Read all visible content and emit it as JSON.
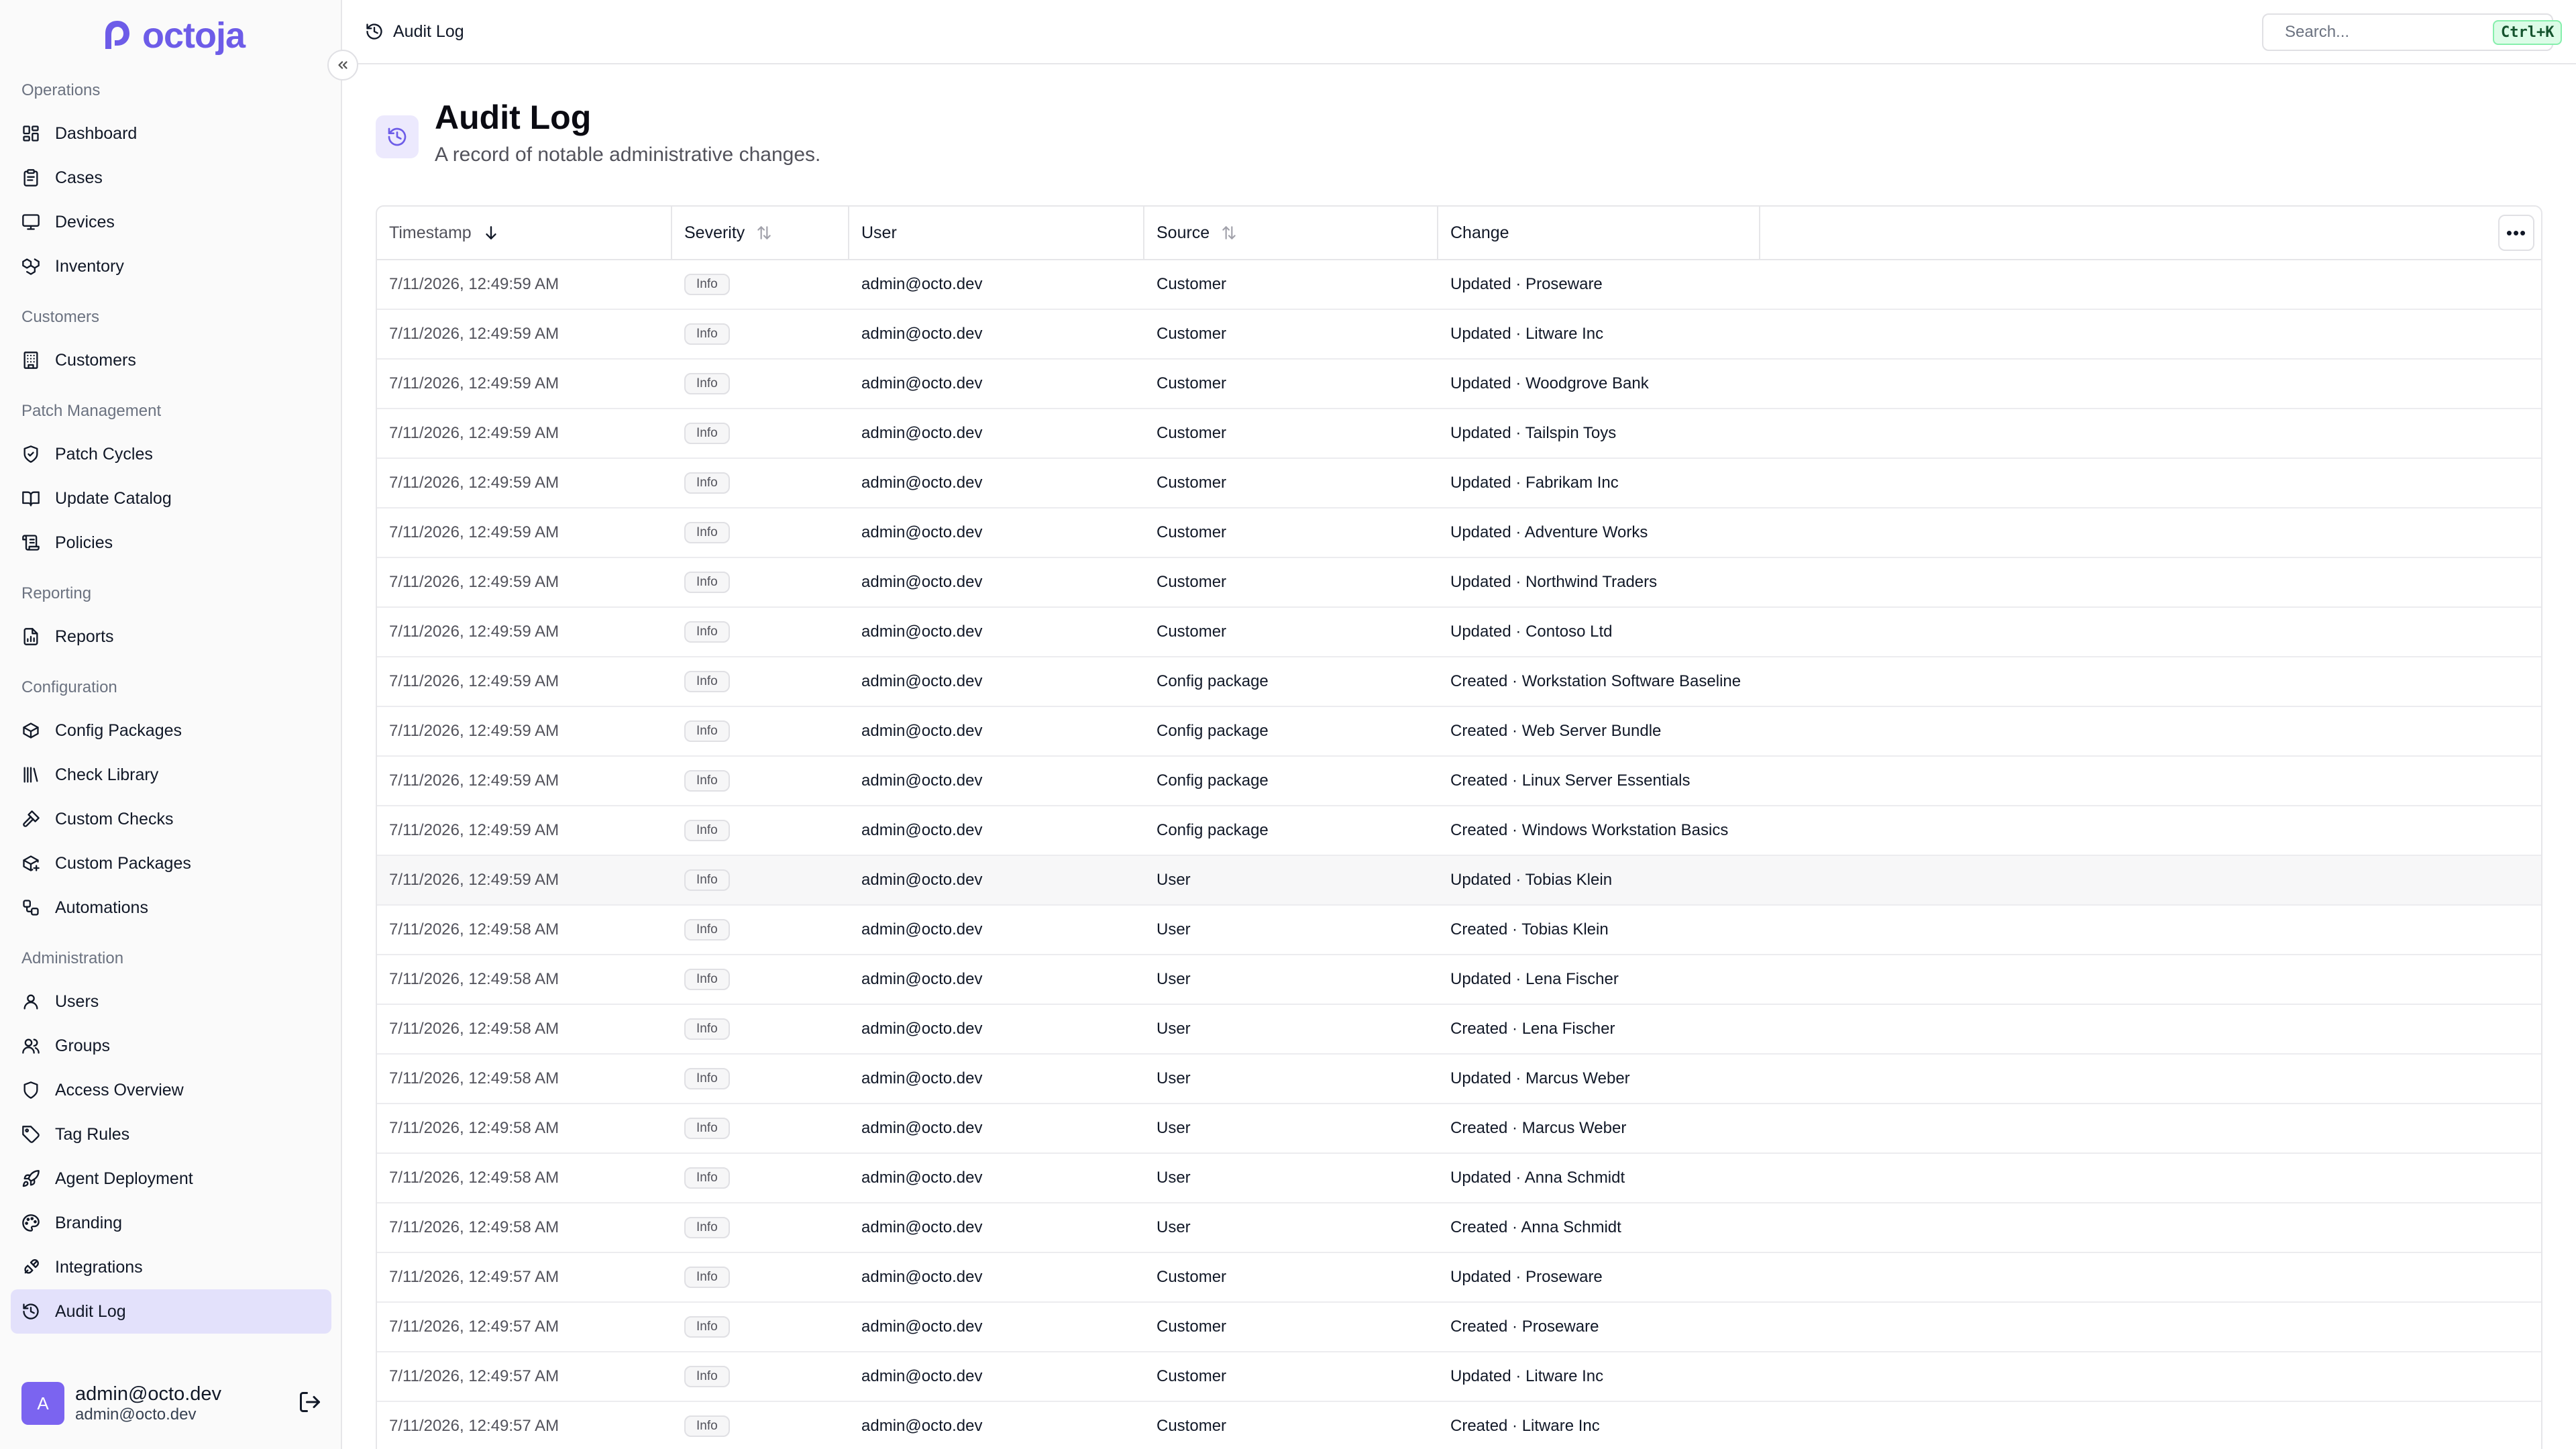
{
  "app": {
    "name": "octoja"
  },
  "sidebar": {
    "groups": [
      {
        "label": "Operations",
        "items": [
          {
            "label": "Dashboard",
            "icon": "dashboard-icon"
          },
          {
            "label": "Cases",
            "icon": "clipboard-icon"
          },
          {
            "label": "Devices",
            "icon": "monitor-icon"
          },
          {
            "label": "Inventory",
            "icon": "boxes-icon"
          }
        ]
      },
      {
        "label": "Customers",
        "items": [
          {
            "label": "Customers",
            "icon": "building-icon"
          }
        ]
      },
      {
        "label": "Patch Management",
        "items": [
          {
            "label": "Patch Cycles",
            "icon": "shield-check-icon"
          },
          {
            "label": "Update Catalog",
            "icon": "book-open-icon"
          },
          {
            "label": "Policies",
            "icon": "scroll-icon"
          }
        ]
      },
      {
        "label": "Reporting",
        "items": [
          {
            "label": "Reports",
            "icon": "report-icon"
          }
        ]
      },
      {
        "label": "Configuration",
        "items": [
          {
            "label": "Config Packages",
            "icon": "package-icon"
          },
          {
            "label": "Check Library",
            "icon": "library-icon"
          },
          {
            "label": "Custom Checks",
            "icon": "hammer-icon"
          },
          {
            "label": "Custom Packages",
            "icon": "package-plus-icon"
          },
          {
            "label": "Automations",
            "icon": "workflow-icon"
          }
        ]
      },
      {
        "label": "Administration",
        "items": [
          {
            "label": "Users",
            "icon": "user-icon"
          },
          {
            "label": "Groups",
            "icon": "users-icon"
          },
          {
            "label": "Access Overview",
            "icon": "shield-icon"
          },
          {
            "label": "Tag Rules",
            "icon": "tag-icon"
          },
          {
            "label": "Agent Deployment",
            "icon": "rocket-icon"
          },
          {
            "label": "Branding",
            "icon": "palette-icon"
          },
          {
            "label": "Integrations",
            "icon": "plug-icon"
          },
          {
            "label": "Audit Log",
            "icon": "history-icon",
            "active": true
          }
        ]
      }
    ],
    "user": {
      "avatar_initial": "A",
      "name": "admin@octo.dev",
      "email": "admin@octo.dev"
    }
  },
  "topbar": {
    "breadcrumb": "Audit Log",
    "search_placeholder": "Search...",
    "shortcut": "Ctrl+K"
  },
  "page": {
    "title": "Audit Log",
    "subtitle": "A record of notable administrative changes."
  },
  "table": {
    "columns": [
      {
        "label": "Timestamp",
        "sort": "desc"
      },
      {
        "label": "Severity",
        "sort": "none"
      },
      {
        "label": "User"
      },
      {
        "label": "Source",
        "sort": "none"
      },
      {
        "label": "Change"
      }
    ],
    "rows": [
      {
        "timestamp": "7/11/2026, 12:49:59 AM",
        "severity": "Info",
        "user": "admin@octo.dev",
        "source": "Customer",
        "change": "Updated · Proseware"
      },
      {
        "timestamp": "7/11/2026, 12:49:59 AM",
        "severity": "Info",
        "user": "admin@octo.dev",
        "source": "Customer",
        "change": "Updated · Litware Inc"
      },
      {
        "timestamp": "7/11/2026, 12:49:59 AM",
        "severity": "Info",
        "user": "admin@octo.dev",
        "source": "Customer",
        "change": "Updated · Woodgrove Bank"
      },
      {
        "timestamp": "7/11/2026, 12:49:59 AM",
        "severity": "Info",
        "user": "admin@octo.dev",
        "source": "Customer",
        "change": "Updated · Tailspin Toys"
      },
      {
        "timestamp": "7/11/2026, 12:49:59 AM",
        "severity": "Info",
        "user": "admin@octo.dev",
        "source": "Customer",
        "change": "Updated · Fabrikam Inc"
      },
      {
        "timestamp": "7/11/2026, 12:49:59 AM",
        "severity": "Info",
        "user": "admin@octo.dev",
        "source": "Customer",
        "change": "Updated · Adventure Works"
      },
      {
        "timestamp": "7/11/2026, 12:49:59 AM",
        "severity": "Info",
        "user": "admin@octo.dev",
        "source": "Customer",
        "change": "Updated · Northwind Traders"
      },
      {
        "timestamp": "7/11/2026, 12:49:59 AM",
        "severity": "Info",
        "user": "admin@octo.dev",
        "source": "Customer",
        "change": "Updated · Contoso Ltd"
      },
      {
        "timestamp": "7/11/2026, 12:49:59 AM",
        "severity": "Info",
        "user": "admin@octo.dev",
        "source": "Config package",
        "change": "Created · Workstation Software Baseline"
      },
      {
        "timestamp": "7/11/2026, 12:49:59 AM",
        "severity": "Info",
        "user": "admin@octo.dev",
        "source": "Config package",
        "change": "Created · Web Server Bundle"
      },
      {
        "timestamp": "7/11/2026, 12:49:59 AM",
        "severity": "Info",
        "user": "admin@octo.dev",
        "source": "Config package",
        "change": "Created · Linux Server Essentials"
      },
      {
        "timestamp": "7/11/2026, 12:49:59 AM",
        "severity": "Info",
        "user": "admin@octo.dev",
        "source": "Config package",
        "change": "Created · Windows Workstation Basics"
      },
      {
        "timestamp": "7/11/2026, 12:49:59 AM",
        "severity": "Info",
        "user": "admin@octo.dev",
        "source": "User",
        "change": "Updated · Tobias Klein",
        "hover": true
      },
      {
        "timestamp": "7/11/2026, 12:49:58 AM",
        "severity": "Info",
        "user": "admin@octo.dev",
        "source": "User",
        "change": "Created · Tobias Klein"
      },
      {
        "timestamp": "7/11/2026, 12:49:58 AM",
        "severity": "Info",
        "user": "admin@octo.dev",
        "source": "User",
        "change": "Updated · Lena Fischer"
      },
      {
        "timestamp": "7/11/2026, 12:49:58 AM",
        "severity": "Info",
        "user": "admin@octo.dev",
        "source": "User",
        "change": "Created · Lena Fischer"
      },
      {
        "timestamp": "7/11/2026, 12:49:58 AM",
        "severity": "Info",
        "user": "admin@octo.dev",
        "source": "User",
        "change": "Updated · Marcus Weber"
      },
      {
        "timestamp": "7/11/2026, 12:49:58 AM",
        "severity": "Info",
        "user": "admin@octo.dev",
        "source": "User",
        "change": "Created · Marcus Weber"
      },
      {
        "timestamp": "7/11/2026, 12:49:58 AM",
        "severity": "Info",
        "user": "admin@octo.dev",
        "source": "User",
        "change": "Updated · Anna Schmidt"
      },
      {
        "timestamp": "7/11/2026, 12:49:58 AM",
        "severity": "Info",
        "user": "admin@octo.dev",
        "source": "User",
        "change": "Created · Anna Schmidt"
      },
      {
        "timestamp": "7/11/2026, 12:49:57 AM",
        "severity": "Info",
        "user": "admin@octo.dev",
        "source": "Customer",
        "change": "Updated · Proseware"
      },
      {
        "timestamp": "7/11/2026, 12:49:57 AM",
        "severity": "Info",
        "user": "admin@octo.dev",
        "source": "Customer",
        "change": "Created · Proseware"
      },
      {
        "timestamp": "7/11/2026, 12:49:57 AM",
        "severity": "Info",
        "user": "admin@octo.dev",
        "source": "Customer",
        "change": "Updated · Litware Inc"
      },
      {
        "timestamp": "7/11/2026, 12:49:57 AM",
        "severity": "Info",
        "user": "admin@octo.dev",
        "source": "Customer",
        "change": "Created · Litware Inc"
      }
    ]
  },
  "colors": {
    "accent": "#6d5ce8",
    "active_bg": "#e3e1fb",
    "kbd_bg": "#dcfce7"
  }
}
